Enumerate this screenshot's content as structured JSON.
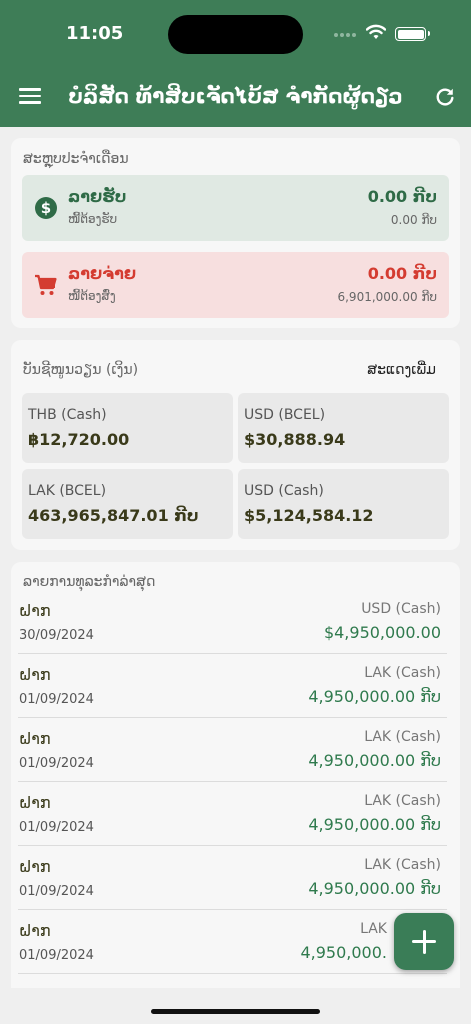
{
  "status": {
    "time": "11:05"
  },
  "header": {
    "title": "ບໍລິສັດ ທ້າສິບເຈັດໄບ້ສ ຈຳກັດຜູ້ດຽວ"
  },
  "summary": {
    "title": "ສະຫຼຸບປະຈຳເດືອນ",
    "income": {
      "label": "ລາຍຮັບ",
      "sublabel": "ໜີ້ຕ້ອງຮັບ",
      "amount": "0.00 ກີບ",
      "sub_amount": "0.00 ກີບ"
    },
    "expense": {
      "label": "ລາຍຈ່າຍ",
      "sublabel": "ໜີ້ຕ້ອງສົ່ງ",
      "amount": "0.00 ກີບ",
      "sub_amount": "6,901,000.00 ກີບ"
    }
  },
  "accounts": {
    "title": "ບັນຊີໜູນວຽນ (ເງິນ)",
    "show_more": "ສະແດງເພີ່ມ",
    "items": [
      {
        "name": "THB (Cash)",
        "balance": "฿12,720.00"
      },
      {
        "name": "USD (BCEL)",
        "balance": "$30,888.94"
      },
      {
        "name": "LAK (BCEL)",
        "balance": "463,965,847.01 ກີບ"
      },
      {
        "name": "USD (Cash)",
        "balance": "$5,124,584.12"
      }
    ]
  },
  "transactions": {
    "title": "ລາຍການທຸລະກຳລ່າສຸດ",
    "items": [
      {
        "type": "ຝາກ",
        "date": "30/09/2024",
        "account": "USD (Cash)",
        "amount": "$4,950,000.00"
      },
      {
        "type": "ຝາກ",
        "date": "01/09/2024",
        "account": "LAK (Cash)",
        "amount": "4,950,000.00 ກີບ"
      },
      {
        "type": "ຝາກ",
        "date": "01/09/2024",
        "account": "LAK (Cash)",
        "amount": "4,950,000.00 ກີບ"
      },
      {
        "type": "ຝາກ",
        "date": "01/09/2024",
        "account": "LAK (Cash)",
        "amount": "4,950,000.00 ກີບ"
      },
      {
        "type": "ຝາກ",
        "date": "01/09/2024",
        "account": "LAK (Cash)",
        "amount": "4,950,000.00 ກີບ"
      },
      {
        "type": "ຝາກ",
        "date": "01/09/2024",
        "account": "LAK",
        "amount": "4,950,000."
      }
    ]
  },
  "icons": {
    "menu": "hamburger-menu-icon",
    "refresh": "refresh-icon",
    "income": "dollar-circle-icon",
    "expense": "shopping-cart-icon",
    "fab": "plus-icon"
  },
  "colors": {
    "brand": "#3e7d57",
    "income_bg": "#e0e9e3",
    "income_text": "#2f6b47",
    "expense_bg": "#f7dfdf",
    "expense_text": "#d43c31",
    "amount_green": "#2f7a4d"
  }
}
